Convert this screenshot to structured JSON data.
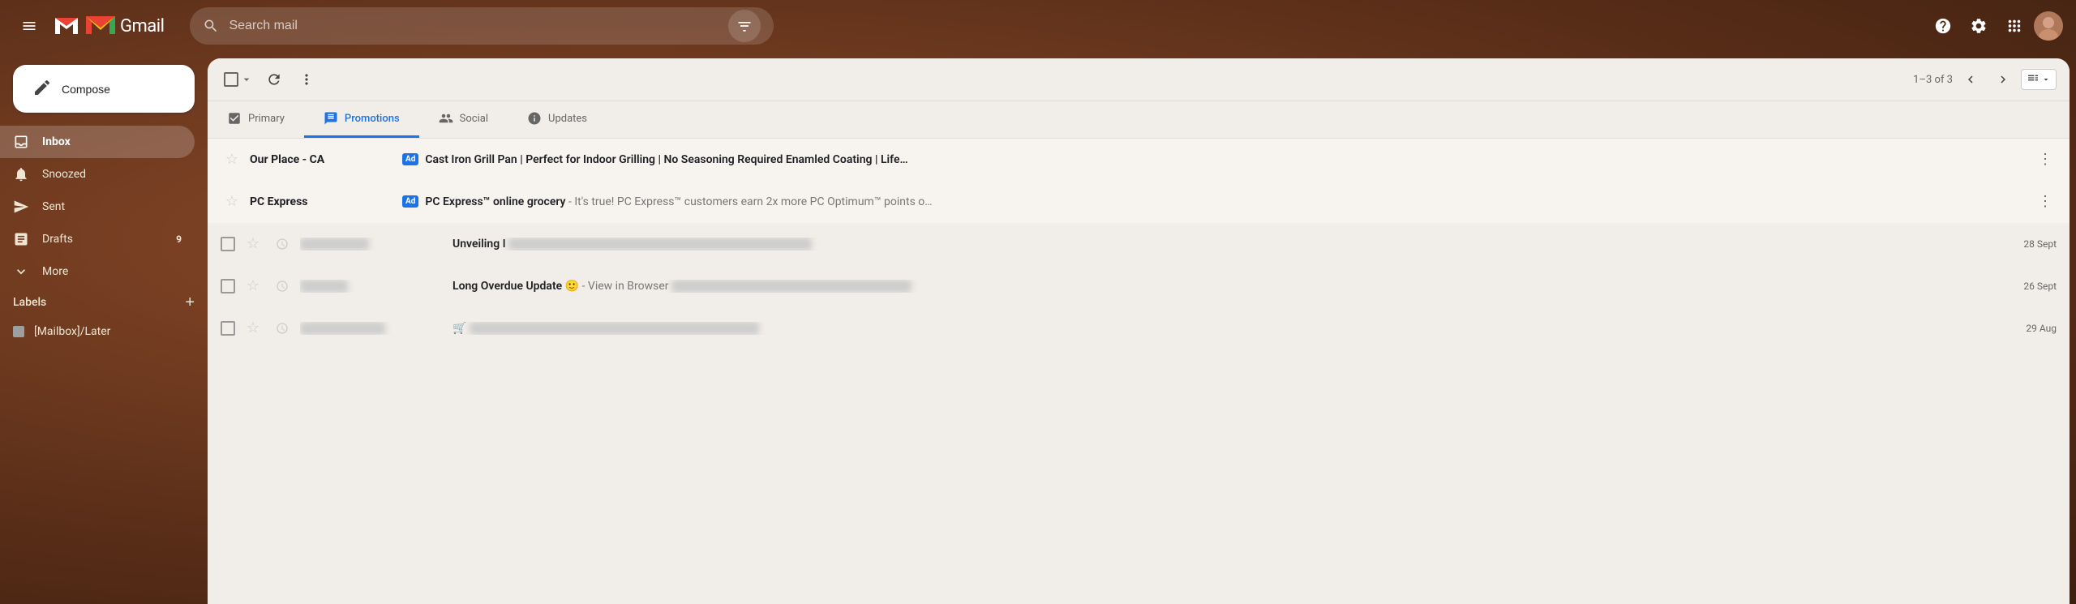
{
  "topbar": {
    "hamburger_label": "Main menu",
    "gmail_label": "Gmail",
    "search_placeholder": "Search mail",
    "filter_label": "Search filters"
  },
  "compose": {
    "label": "Compose",
    "pen_icon": "✏️"
  },
  "nav": {
    "items": [
      {
        "id": "inbox",
        "label": "Inbox",
        "icon": "inbox",
        "active": true,
        "count": ""
      },
      {
        "id": "snoozed",
        "label": "Snoozed",
        "icon": "snooze",
        "active": false,
        "count": ""
      },
      {
        "id": "sent",
        "label": "Sent",
        "icon": "send",
        "active": false,
        "count": ""
      },
      {
        "id": "drafts",
        "label": "Drafts",
        "icon": "draft",
        "active": false,
        "count": "9"
      },
      {
        "id": "more",
        "label": "More",
        "icon": "more",
        "active": false,
        "count": ""
      }
    ]
  },
  "labels": {
    "header": "Labels",
    "add_label": "+",
    "items": [
      {
        "id": "mailbox-later",
        "label": "[Mailbox]/Later",
        "color": "#9e9e9e"
      }
    ]
  },
  "toolbar": {
    "select_label": "Select",
    "refresh_label": "Refresh",
    "more_label": "More options",
    "pagination": "1–3 of 3",
    "prev_label": "Older",
    "next_label": "Newer"
  },
  "tabs": [
    {
      "id": "primary",
      "label": "Primary",
      "icon": "☰",
      "active": false
    },
    {
      "id": "promotions",
      "label": "Promotions",
      "icon": "🏷",
      "active": true
    },
    {
      "id": "social",
      "label": "Social",
      "icon": "👥",
      "active": false
    },
    {
      "id": "updates",
      "label": "Updates",
      "icon": "ℹ",
      "active": false
    }
  ],
  "emails": [
    {
      "id": "email-1",
      "is_ad": true,
      "sender": "Our Place - CA",
      "ad_badge": "Ad",
      "subject": "Cast Iron Grill Pan | Perfect for Indoor Grilling | No Seasoning Required Enamled Coating | Life…",
      "preview": "",
      "date": "",
      "has_checkbox": false,
      "has_star": true,
      "has_snooze": false
    },
    {
      "id": "email-2",
      "is_ad": true,
      "sender": "PC Express",
      "ad_badge": "Ad",
      "subject": "PC Express™ online grocery",
      "preview": " - It's true! PC Express™ customers earn 2x more PC Optimum™ points o…",
      "date": "",
      "has_checkbox": false,
      "has_star": true,
      "has_snooze": false
    },
    {
      "id": "email-3",
      "is_ad": false,
      "sender": "blurred_sender_1",
      "ad_badge": "",
      "subject": "Unveiling I",
      "preview_blurred": "blurred preview content here lorem ipsum dolor",
      "date": "28 Sept",
      "has_checkbox": true,
      "has_star": true,
      "has_snooze": true
    },
    {
      "id": "email-4",
      "is_ad": false,
      "sender": "blurred_sender_2",
      "ad_badge": "",
      "subject": "Long Overdue Update 🙂",
      "preview": " - View in Browser ",
      "preview_blurred": "blurred more content here",
      "date": "26 Sept",
      "has_checkbox": true,
      "has_star": true,
      "has_snooze": true
    },
    {
      "id": "email-5",
      "is_ad": false,
      "sender": "blurred_sender_3",
      "ad_badge": "",
      "subject": "🛒",
      "preview_blurred": "blurred subject and preview content lorem ipsum",
      "date": "29 Aug",
      "has_checkbox": true,
      "has_star": true,
      "has_snooze": true
    }
  ],
  "colors": {
    "active_tab": "#1a73e8",
    "ad_badge_bg": "#1a73e8",
    "compose_bg": "#ffffff",
    "panel_bg": "#f1ede8"
  }
}
